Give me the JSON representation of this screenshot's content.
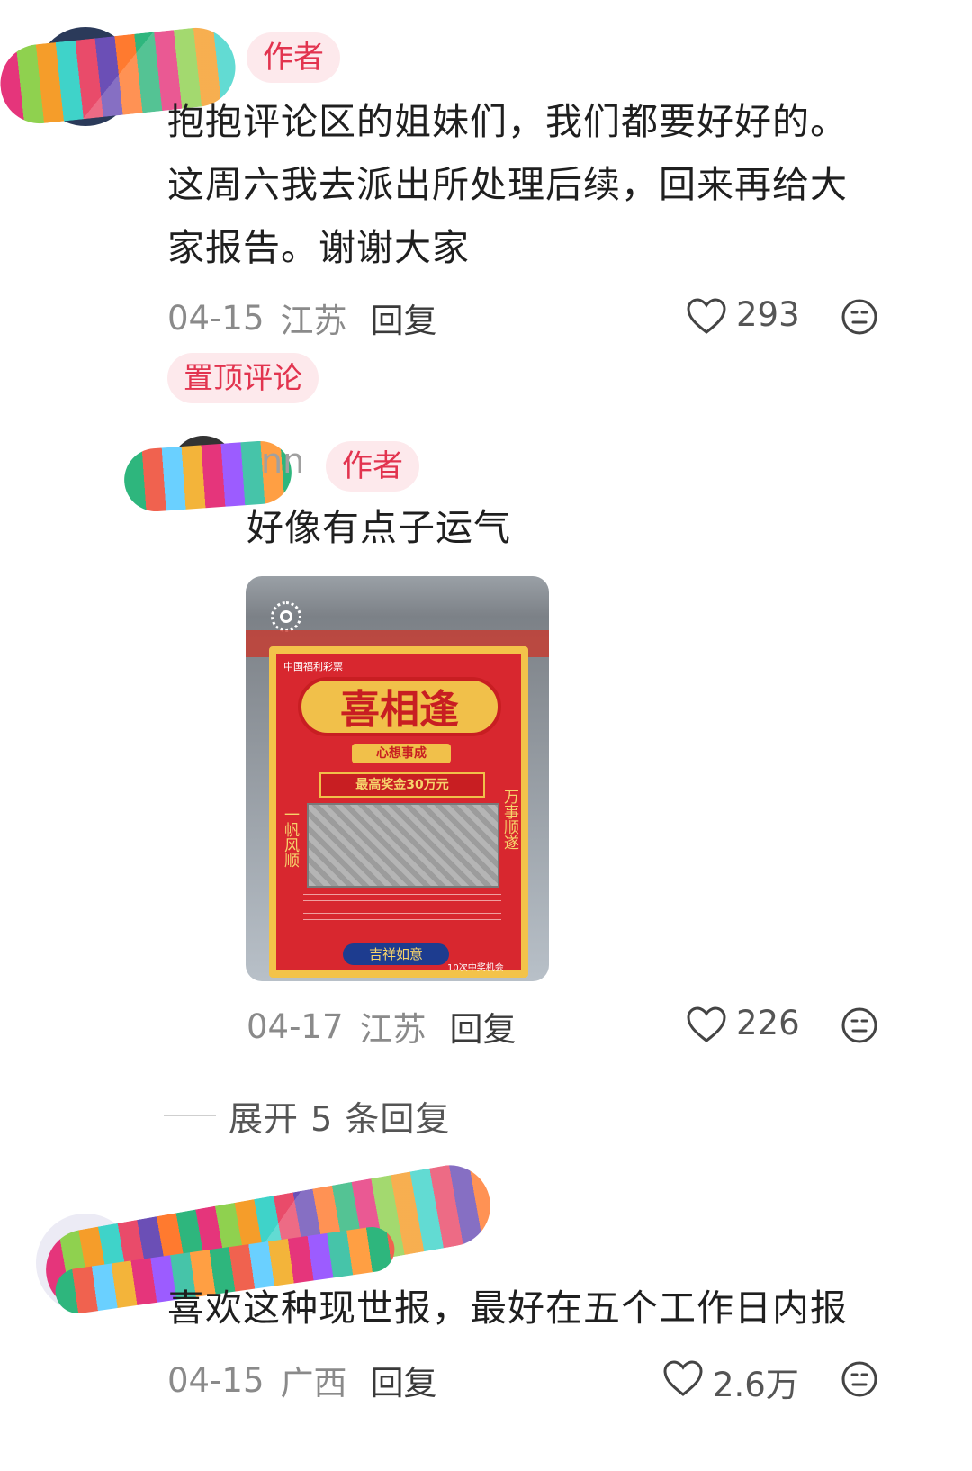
{
  "comments": [
    {
      "tag": "作者",
      "text_lines": [
        "抱抱评论区的姐妹们，我们都要好好的。",
        "这周六我去派出所处理后续，回来再给大",
        "家报告。谢谢大家"
      ],
      "date": "04-15",
      "location": "江苏",
      "reply_label": "回复",
      "likes": "293",
      "pinned_label": "置顶评论"
    },
    {
      "username_partial": "nn",
      "tag": "作者",
      "text": "好像有点子运气",
      "image": {
        "ticket_header": "中国福利彩票",
        "ticket_title": "喜相逢",
        "ticket_banner": "心想事成",
        "ticket_prize": "最高奖金30万元",
        "ticket_side_left": "一帆风顺",
        "ticket_side_right": "万事顺遂",
        "ticket_footer": "吉祥如意",
        "ticket_chances": "10次中奖机会"
      },
      "date": "04-17",
      "location": "江苏",
      "reply_label": "回复",
      "likes": "226"
    },
    {
      "text": "喜欢这种现世报，最好在五个工作日内报",
      "date": "04-15",
      "location": "广西",
      "reply_label": "回复",
      "likes": "2.6万"
    }
  ],
  "expand_replies": "展开 5 条回复",
  "icons": {
    "heart": "heart-icon",
    "emoji": "neutral-face-icon",
    "live": "live-photo-icon"
  },
  "colors": {
    "tag_bg": "#fde9ec",
    "tag_text": "#e2344f"
  }
}
